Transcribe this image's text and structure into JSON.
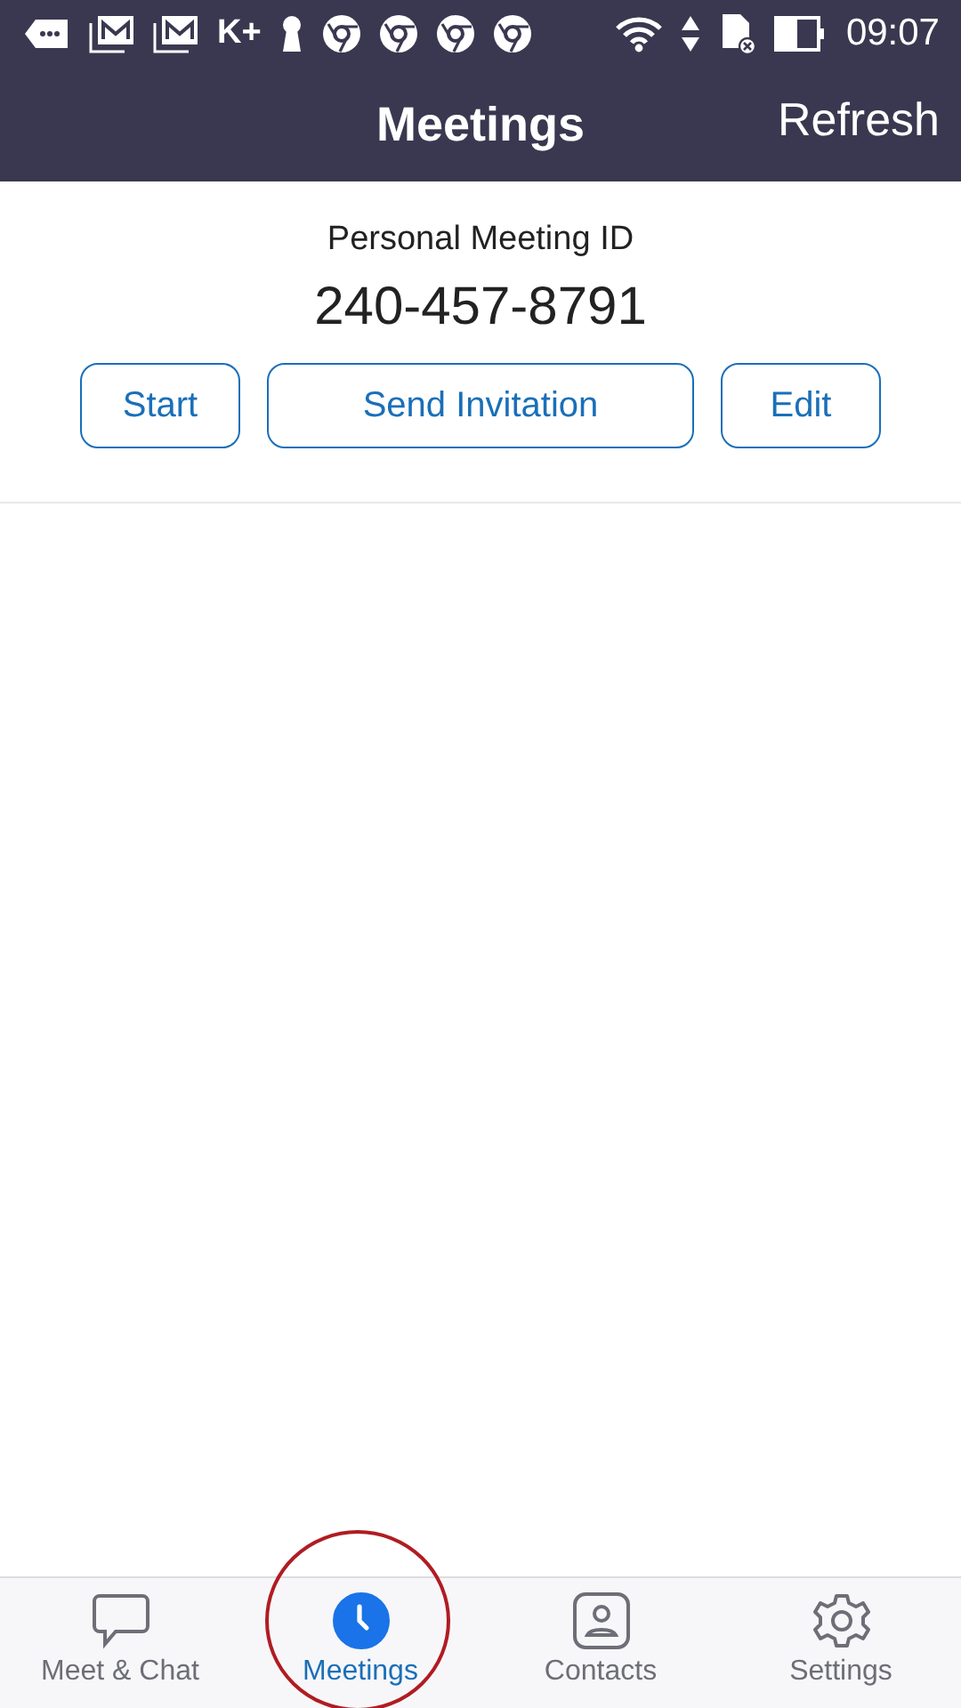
{
  "status_bar": {
    "app_label": "K+",
    "time": "09:07"
  },
  "header": {
    "title": "Meetings",
    "action": "Refresh"
  },
  "personal_meeting": {
    "label": "Personal Meeting ID",
    "id": "240-457-8791",
    "buttons": [
      "Start",
      "Send Invitation",
      "Edit"
    ]
  },
  "tabs": [
    {
      "label": "Meet & Chat",
      "kind": "chat",
      "selected": false
    },
    {
      "label": "Meetings",
      "kind": "clock",
      "selected": true
    },
    {
      "label": "Contacts",
      "kind": "contact",
      "selected": false
    },
    {
      "label": "Settings",
      "kind": "gear",
      "selected": false
    }
  ],
  "annotation": {
    "kind": "ellipse",
    "color": "#b01c22"
  }
}
